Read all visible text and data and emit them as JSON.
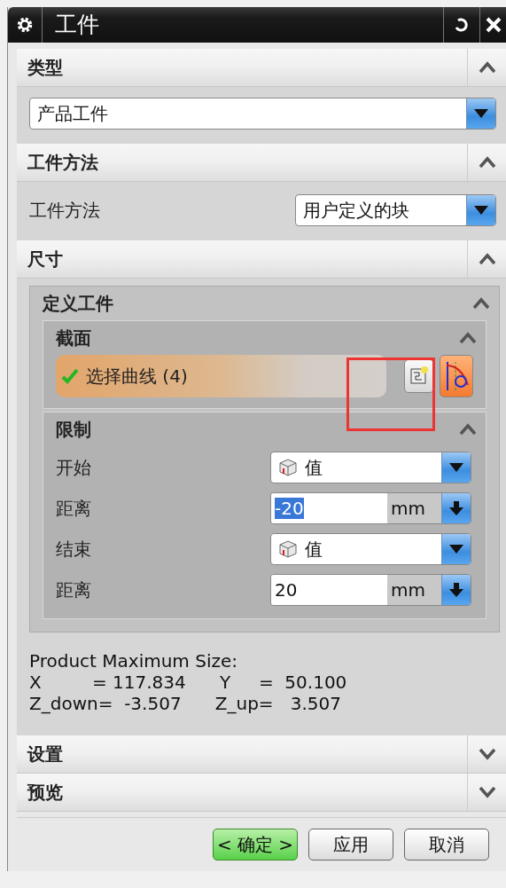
{
  "window": {
    "title": "工件"
  },
  "sections": [
    {
      "kind": "type",
      "title": "类型",
      "expanded": true,
      "dropdown": {
        "value": "产品工件"
      }
    },
    {
      "kind": "method",
      "title": "工件方法",
      "expanded": true,
      "label": "工件方法",
      "dropdown": {
        "value": "用户定义的块"
      }
    },
    {
      "kind": "size",
      "title": "尺寸",
      "expanded": true,
      "panel": {
        "title": "定义工件",
        "expanded": true,
        "section_group": {
          "title": "截面",
          "expanded": true,
          "selection": {
            "label": "选择曲线 (4)",
            "complete": true
          },
          "tools": [
            {
              "active": false
            },
            {
              "active": true
            }
          ]
        },
        "limits": {
          "title": "限制",
          "expanded": true,
          "rows": [
            {
              "kind": "select",
              "label": "开始",
              "value": "值"
            },
            {
              "kind": "distance",
              "label": "距离",
              "value": "-20",
              "unit": "mm",
              "text_selected": true
            },
            {
              "kind": "select",
              "label": "结束",
              "value": "值"
            },
            {
              "kind": "distance",
              "label": "距离",
              "value": "20",
              "unit": "mm",
              "text_selected": false
            }
          ]
        }
      },
      "info": [
        "Product Maximum Size:",
        "X         = 117.834      Y     =  50.100",
        "Z_down=  -3.507      Z_up=   3.507"
      ]
    },
    {
      "title": "设置",
      "expanded": false
    },
    {
      "title": "预览",
      "expanded": false
    }
  ],
  "buttons": [
    {
      "label": "< 确定 >",
      "default": true
    },
    {
      "label": "应用",
      "default": false
    },
    {
      "label": "取消",
      "default": false
    }
  ]
}
